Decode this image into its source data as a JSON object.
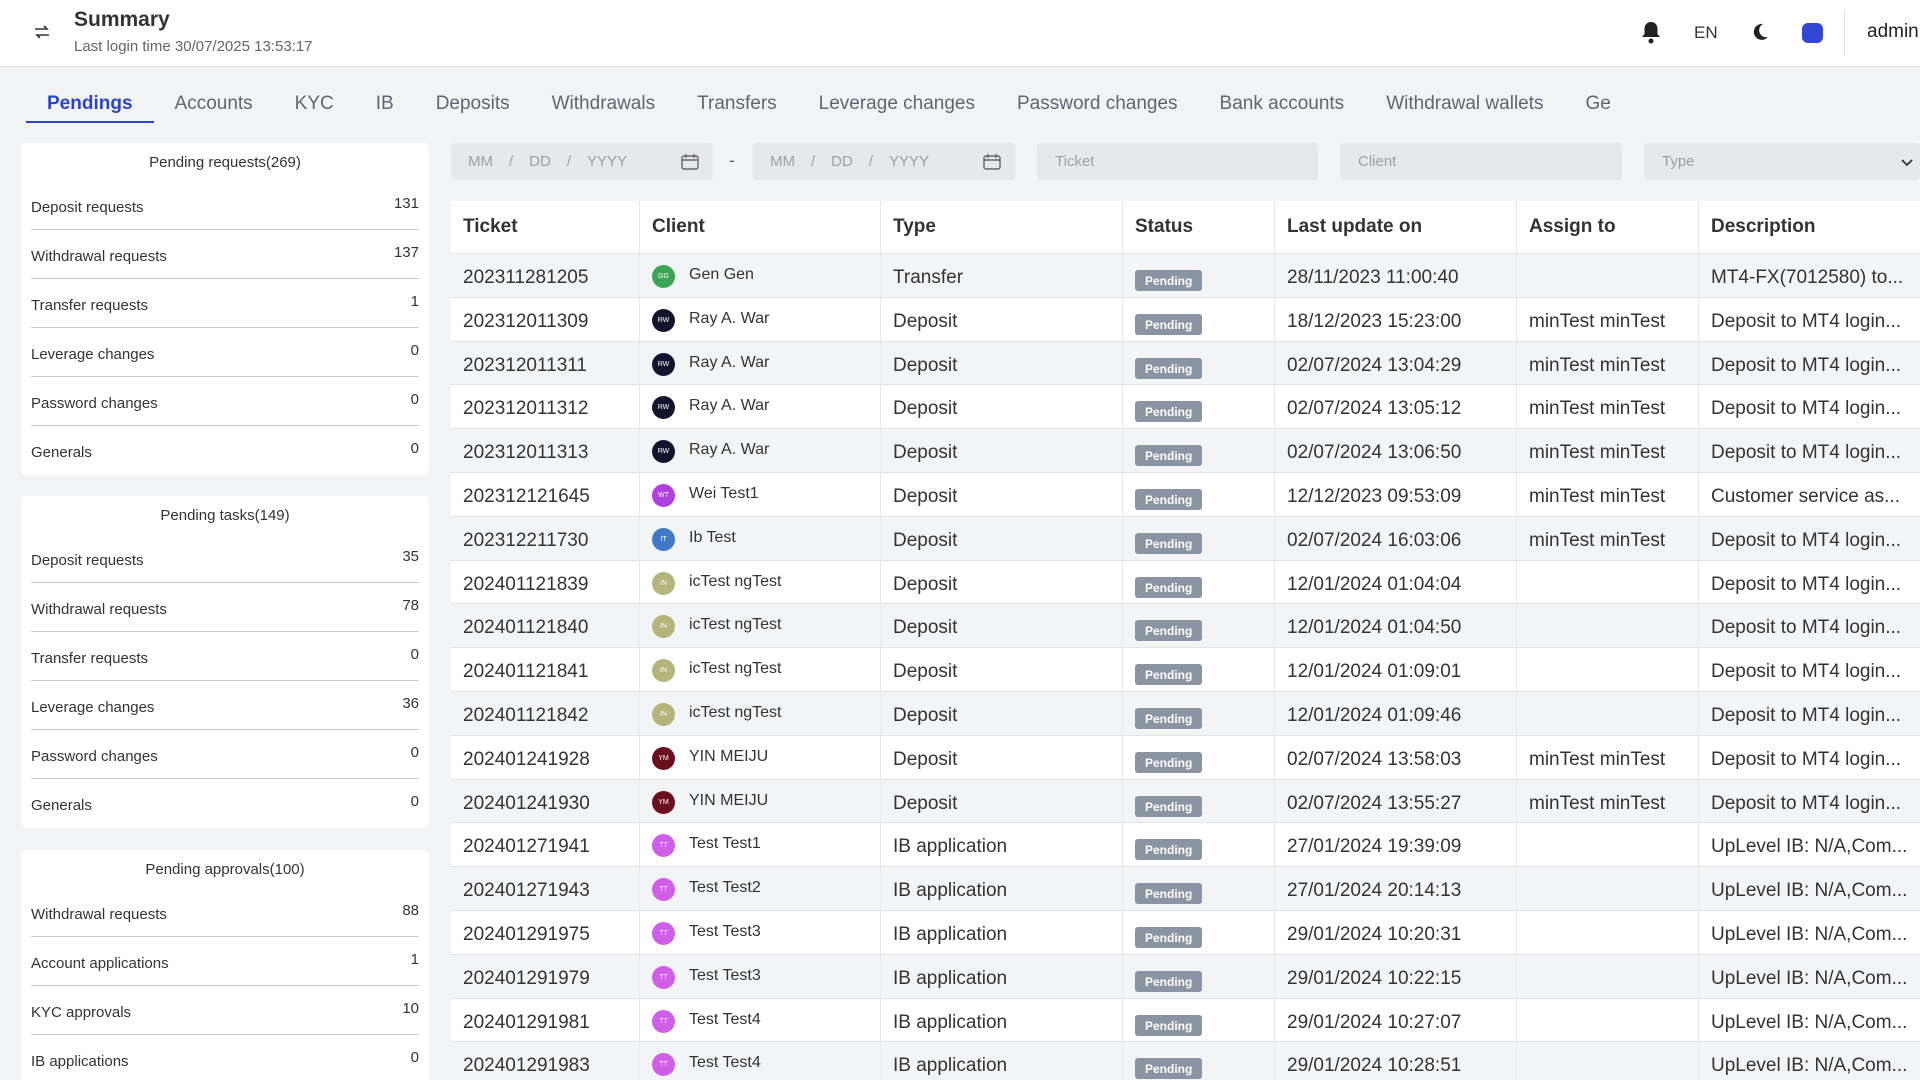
{
  "header": {
    "title": "Summary",
    "last_login": "Last login time 30/07/2025 13:53:17",
    "lang": "EN",
    "user": "admin",
    "collapse_icon": "swap-arrows-icon",
    "bell_icon": "bell-icon",
    "moon_icon": "moon-icon",
    "theme_color": "#3347d5"
  },
  "tabs": [
    {
      "label": "Pendings",
      "active": true
    },
    {
      "label": "Accounts"
    },
    {
      "label": "KYC"
    },
    {
      "label": "IB"
    },
    {
      "label": "Deposits"
    },
    {
      "label": "Withdrawals"
    },
    {
      "label": "Transfers"
    },
    {
      "label": "Leverage changes"
    },
    {
      "label": "Password changes"
    },
    {
      "label": "Bank accounts"
    },
    {
      "label": "Withdrawal wallets"
    },
    {
      "label": "Ge"
    }
  ],
  "summary": {
    "requests": {
      "title": "Pending requests(269)",
      "rows": [
        {
          "label": "Deposit requests",
          "value": "131"
        },
        {
          "label": "Withdrawal requests",
          "value": "137"
        },
        {
          "label": "Transfer requests",
          "value": "1"
        },
        {
          "label": "Leverage changes",
          "value": "0"
        },
        {
          "label": "Password changes",
          "value": "0"
        },
        {
          "label": "Generals",
          "value": "0"
        }
      ]
    },
    "tasks": {
      "title": "Pending tasks(149)",
      "rows": [
        {
          "label": "Deposit requests",
          "value": "35"
        },
        {
          "label": "Withdrawal requests",
          "value": "78"
        },
        {
          "label": "Transfer requests",
          "value": "0"
        },
        {
          "label": "Leverage changes",
          "value": "36"
        },
        {
          "label": "Password changes",
          "value": "0"
        },
        {
          "label": "Generals",
          "value": "0"
        }
      ]
    },
    "approvals": {
      "title": "Pending approvals(100)",
      "rows": [
        {
          "label": "Withdrawal requests",
          "value": "88"
        },
        {
          "label": "Account applications",
          "value": "1"
        },
        {
          "label": "KYC approvals",
          "value": "10"
        },
        {
          "label": "IB applications",
          "value": "0"
        }
      ]
    }
  },
  "filters": {
    "date_from": {
      "mm": "MM",
      "sep1": "/",
      "dd": "DD",
      "sep2": "/",
      "yyyy": "YYYY"
    },
    "date_to": {
      "mm": "MM",
      "sep1": "/",
      "dd": "DD",
      "sep2": "/",
      "yyyy": "YYYY"
    },
    "dash": "-",
    "ticket_placeholder": "Ticket",
    "client_placeholder": "Client",
    "type_placeholder": "Type"
  },
  "table": {
    "columns": [
      "Ticket",
      "Client",
      "Type",
      "Status",
      "Last update on",
      "Assign to",
      "Description"
    ],
    "rows": [
      {
        "ticket": "202311281205",
        "initials": "GG",
        "avatar_color": "#3aa655",
        "client": "Gen Gen",
        "type": "Transfer",
        "status": "Pending",
        "last": "28/11/2023 11:00:40",
        "assign": "",
        "desc": "MT4-FX(7012580) to..."
      },
      {
        "ticket": "202312011309",
        "initials": "RW",
        "avatar_color": "#14132e",
        "client": "Ray A. War",
        "type": "Deposit",
        "status": "Pending",
        "last": "18/12/2023 15:23:00",
        "assign": "minTest minTest",
        "desc": "Deposit to MT4 login..."
      },
      {
        "ticket": "202312011311",
        "initials": "RW",
        "avatar_color": "#14132e",
        "client": "Ray A. War",
        "type": "Deposit",
        "status": "Pending",
        "last": "02/07/2024 13:04:29",
        "assign": "minTest minTest",
        "desc": "Deposit to MT4 login..."
      },
      {
        "ticket": "202312011312",
        "initials": "RW",
        "avatar_color": "#14132e",
        "client": "Ray A. War",
        "type": "Deposit",
        "status": "Pending",
        "last": "02/07/2024 13:05:12",
        "assign": "minTest minTest",
        "desc": "Deposit to MT4 login..."
      },
      {
        "ticket": "202312011313",
        "initials": "RW",
        "avatar_color": "#14132e",
        "client": "Ray A. War",
        "type": "Deposit",
        "status": "Pending",
        "last": "02/07/2024 13:06:50",
        "assign": "minTest minTest",
        "desc": "Deposit to MT4 login..."
      },
      {
        "ticket": "202312121645",
        "initials": "WT",
        "avatar_color": "#b140e0",
        "client": "Wei Test1",
        "type": "Deposit",
        "status": "Pending",
        "last": "12/12/2023 09:53:09",
        "assign": "minTest minTest",
        "desc": "Customer service as..."
      },
      {
        "ticket": "202312211730",
        "initials": "IT",
        "avatar_color": "#3f79c7",
        "client": "Ib Test",
        "type": "Deposit",
        "status": "Pending",
        "last": "02/07/2024 16:03:06",
        "assign": "minTest minTest",
        "desc": "Deposit to MT4 login..."
      },
      {
        "ticket": "202401121839",
        "initials": "IN",
        "avatar_color": "#b5b47a",
        "client": "icTest ngTest",
        "type": "Deposit",
        "status": "Pending",
        "last": "12/01/2024 01:04:04",
        "assign": "",
        "desc": "Deposit to MT4 login..."
      },
      {
        "ticket": "202401121840",
        "initials": "IN",
        "avatar_color": "#b5b47a",
        "client": "icTest ngTest",
        "type": "Deposit",
        "status": "Pending",
        "last": "12/01/2024 01:04:50",
        "assign": "",
        "desc": "Deposit to MT4 login..."
      },
      {
        "ticket": "202401121841",
        "initials": "IN",
        "avatar_color": "#b5b47a",
        "client": "icTest ngTest",
        "type": "Deposit",
        "status": "Pending",
        "last": "12/01/2024 01:09:01",
        "assign": "",
        "desc": "Deposit to MT4 login..."
      },
      {
        "ticket": "202401121842",
        "initials": "IN",
        "avatar_color": "#b5b47a",
        "client": "icTest ngTest",
        "type": "Deposit",
        "status": "Pending",
        "last": "12/01/2024 01:09:46",
        "assign": "",
        "desc": "Deposit to MT4 login..."
      },
      {
        "ticket": "202401241928",
        "initials": "YM",
        "avatar_color": "#6b0f1e",
        "client": "YIN MEIJU",
        "type": "Deposit",
        "status": "Pending",
        "last": "02/07/2024 13:58:03",
        "assign": "minTest minTest",
        "desc": "Deposit to MT4 login..."
      },
      {
        "ticket": "202401241930",
        "initials": "YM",
        "avatar_color": "#6b0f1e",
        "client": "YIN MEIJU",
        "type": "Deposit",
        "status": "Pending",
        "last": "02/07/2024 13:55:27",
        "assign": "minTest minTest",
        "desc": "Deposit to MT4 login..."
      },
      {
        "ticket": "202401271941",
        "initials": "TT",
        "avatar_color": "#d15ee6",
        "client": "Test Test1",
        "type": "IB application",
        "status": "Pending",
        "last": "27/01/2024 19:39:09",
        "assign": "",
        "desc": "UpLevel IB: N/A,Com..."
      },
      {
        "ticket": "202401271943",
        "initials": "TT",
        "avatar_color": "#d15ee6",
        "client": "Test Test2",
        "type": "IB application",
        "status": "Pending",
        "last": "27/01/2024 20:14:13",
        "assign": "",
        "desc": "UpLevel IB: N/A,Com..."
      },
      {
        "ticket": "202401291975",
        "initials": "TT",
        "avatar_color": "#d15ee6",
        "client": "Test Test3",
        "type": "IB application",
        "status": "Pending",
        "last": "29/01/2024 10:20:31",
        "assign": "",
        "desc": "UpLevel IB: N/A,Com..."
      },
      {
        "ticket": "202401291979",
        "initials": "TT",
        "avatar_color": "#d15ee6",
        "client": "Test Test3",
        "type": "IB application",
        "status": "Pending",
        "last": "29/01/2024 10:22:15",
        "assign": "",
        "desc": "UpLevel IB: N/A,Com..."
      },
      {
        "ticket": "202401291981",
        "initials": "TT",
        "avatar_color": "#d15ee6",
        "client": "Test Test4",
        "type": "IB application",
        "status": "Pending",
        "last": "29/01/2024 10:27:07",
        "assign": "",
        "desc": "UpLevel IB: N/A,Com..."
      },
      {
        "ticket": "202401291983",
        "initials": "TT",
        "avatar_color": "#d15ee6",
        "client": "Test Test4",
        "type": "IB application",
        "status": "Pending",
        "last": "29/01/2024 10:28:51",
        "assign": "",
        "desc": "UpLevel IB: N/A,Com..."
      }
    ]
  }
}
